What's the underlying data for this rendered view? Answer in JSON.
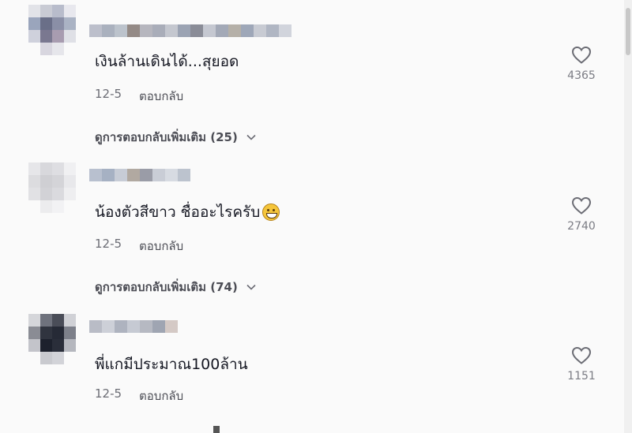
{
  "comments": [
    {
      "text": "เงินล้านเดินได้...สุยอด",
      "date": "12-5",
      "reply_label": "ตอบกลับ",
      "likes": "4365",
      "more_replies": "ดูการตอบกลับเพิ่มเติม (25)",
      "has_emoji": false
    },
    {
      "text": "น้องตัวสีขาว ชื่ออะไรครับ",
      "date": "12-5",
      "reply_label": "ตอบกลับ",
      "likes": "2740",
      "more_replies": "ดูการตอบกลับเพิ่มเติม (74)",
      "has_emoji": true,
      "emoji_icon": "grinning-face-icon"
    },
    {
      "text": "พี่แกมีประมาณ100ล้าน",
      "date": "12-5",
      "reply_label": "ตอบกลับ",
      "likes": "1151"
    }
  ],
  "icons": {
    "like": "heart-outline-icon",
    "expand": "chevron-down-icon"
  },
  "colors": {
    "background": "#fafafa",
    "text": "#161823",
    "secondary": "#6b6c74"
  }
}
